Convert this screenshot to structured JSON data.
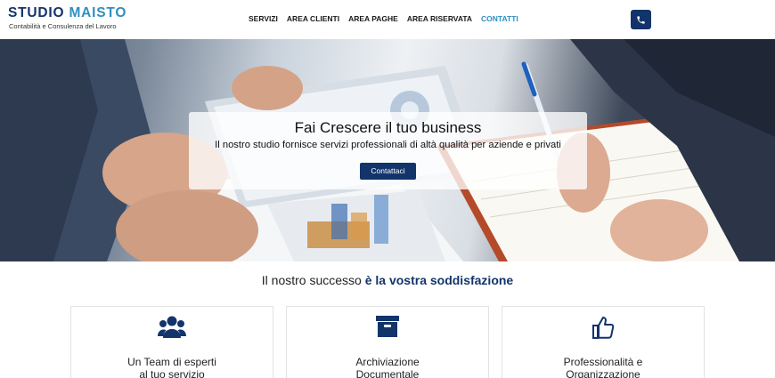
{
  "brand": {
    "name_bold": "STUDIO",
    "name_light": "MAISTO",
    "subtitle": "Contabilità e Consulenza del Lavoro"
  },
  "nav": {
    "items": [
      {
        "label": "SERVIZI"
      },
      {
        "label": "AREA CLIENTI"
      },
      {
        "label": "AREA PAGHE"
      },
      {
        "label": "AREA RISERVATA"
      },
      {
        "label": "CONTATTI"
      }
    ],
    "active": "CONTATTI",
    "phone_icon": "phone-icon"
  },
  "hero": {
    "title": "Fai Crescere il tuo business",
    "text": "Il nostro studio fornisce servizi professionali di altà qualità per aziende e privati",
    "button": "Contattaci"
  },
  "tagline": {
    "normal": "Il nostro successo",
    "bold": "è la vostra soddisfazione"
  },
  "features": [
    {
      "icon": "team-icon",
      "line1": "Un Team di esperti",
      "line2": "al tuo servizio"
    },
    {
      "icon": "archive-box-icon",
      "line1": "Archiviazione",
      "line2": "Documentale"
    },
    {
      "icon": "thumbs-up-icon",
      "line1": "Professionalità e",
      "line2": "Organizzazione"
    }
  ],
  "colors": {
    "primary": "#13346b",
    "accent": "#2f8fc2"
  }
}
